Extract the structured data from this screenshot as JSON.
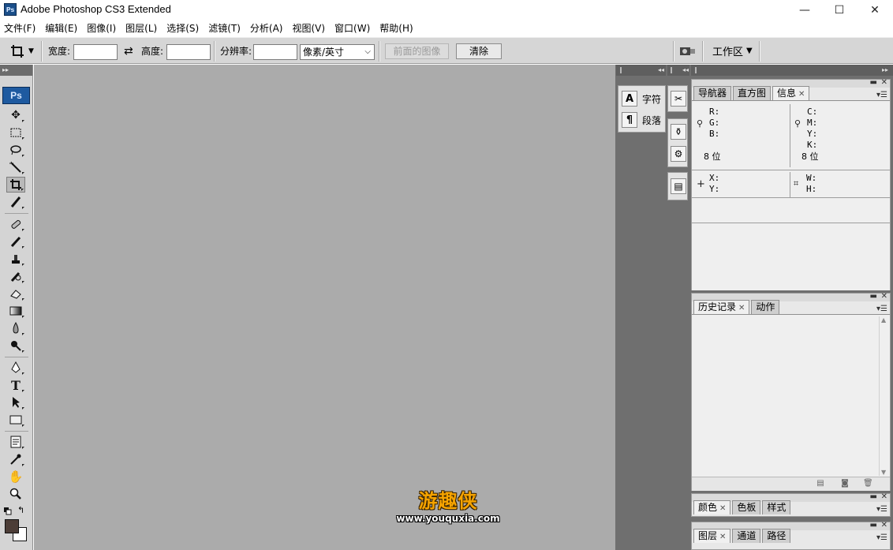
{
  "window": {
    "icon": "Ps",
    "title": "Adobe Photoshop CS3 Extended",
    "minimize": "—",
    "maximize": "☐",
    "close": "✕"
  },
  "menu": [
    "文件(F)",
    "编辑(E)",
    "图像(I)",
    "图层(L)",
    "选择(S)",
    "滤镜(T)",
    "分析(A)",
    "视图(V)",
    "窗口(W)",
    "帮助(H)"
  ],
  "options_bar": {
    "tool_icon": "crop-icon",
    "width_label": "宽度:",
    "width_value": "",
    "swap_icon": "⇄",
    "height_label": "高度:",
    "height_value": "",
    "resolution_label": "分辨率:",
    "resolution_value": "",
    "unit_select": "像素/英寸",
    "front_image_button": "前面的图像",
    "clear_button": "清除",
    "workspace_label": "工作区"
  },
  "toolbox": {
    "logo": "Ps",
    "tools": [
      "move",
      "marquee",
      "lasso",
      "magic-wand",
      "crop",
      "slice",
      "healing-brush",
      "brush",
      "clone-stamp",
      "history-brush",
      "eraser",
      "gradient",
      "blur",
      "dodge",
      "pen",
      "type",
      "path-selection",
      "rectangle",
      "notes",
      "eyedropper",
      "hand",
      "zoom"
    ],
    "foreground_color": "#4c3d37",
    "background_color": "#ffffff"
  },
  "watermark": {
    "name": "游趣侠",
    "url": "www.youquxia.com"
  },
  "dock": {
    "char_panel_label": "字符",
    "para_panel_label": "段落",
    "info_panel": {
      "tabs": [
        "导航器",
        "直方图",
        "信息"
      ],
      "active_tab": "信息",
      "rgb": [
        "R:",
        "G:",
        "B:"
      ],
      "cmyk": [
        "C:",
        "M:",
        "Y:",
        "K:"
      ],
      "bits_left": "8 位",
      "bits_right": "8 位",
      "xy": [
        "X:",
        "Y:"
      ],
      "wh": [
        "W:",
        "H:"
      ]
    },
    "history_panel": {
      "tabs": [
        "历史记录",
        "动作"
      ],
      "active_tab": "历史记录"
    },
    "color_panel": {
      "tabs": [
        "颜色",
        "色板",
        "样式"
      ],
      "active_tab": "颜色"
    },
    "layers_panel": {
      "tabs": [
        "图层",
        "通道",
        "路径"
      ],
      "active_tab": "图层"
    }
  }
}
